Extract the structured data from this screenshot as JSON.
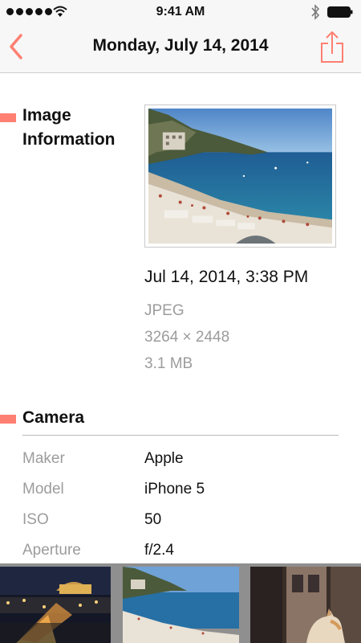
{
  "status_bar": {
    "time": "9:41 AM"
  },
  "nav": {
    "title": "Monday, July 14, 2014"
  },
  "image_info": {
    "heading_line1": "Image",
    "heading_line2": "Information",
    "datetime": "Jul 14, 2014, 3:38 PM",
    "format": "JPEG",
    "dimensions": "3264 × 2448",
    "size": "3.1 MB"
  },
  "camera": {
    "heading": "Camera",
    "rows": [
      {
        "label": "Maker",
        "value": "Apple"
      },
      {
        "label": "Model",
        "value": "iPhone 5"
      },
      {
        "label": "ISO",
        "value": "50"
      },
      {
        "label": "Aperture",
        "value": "f/2.4"
      }
    ]
  },
  "colors": {
    "accent": "#ff7f72",
    "nav_bg": "#f7f7f7",
    "muted_text": "#9c9c9c"
  }
}
